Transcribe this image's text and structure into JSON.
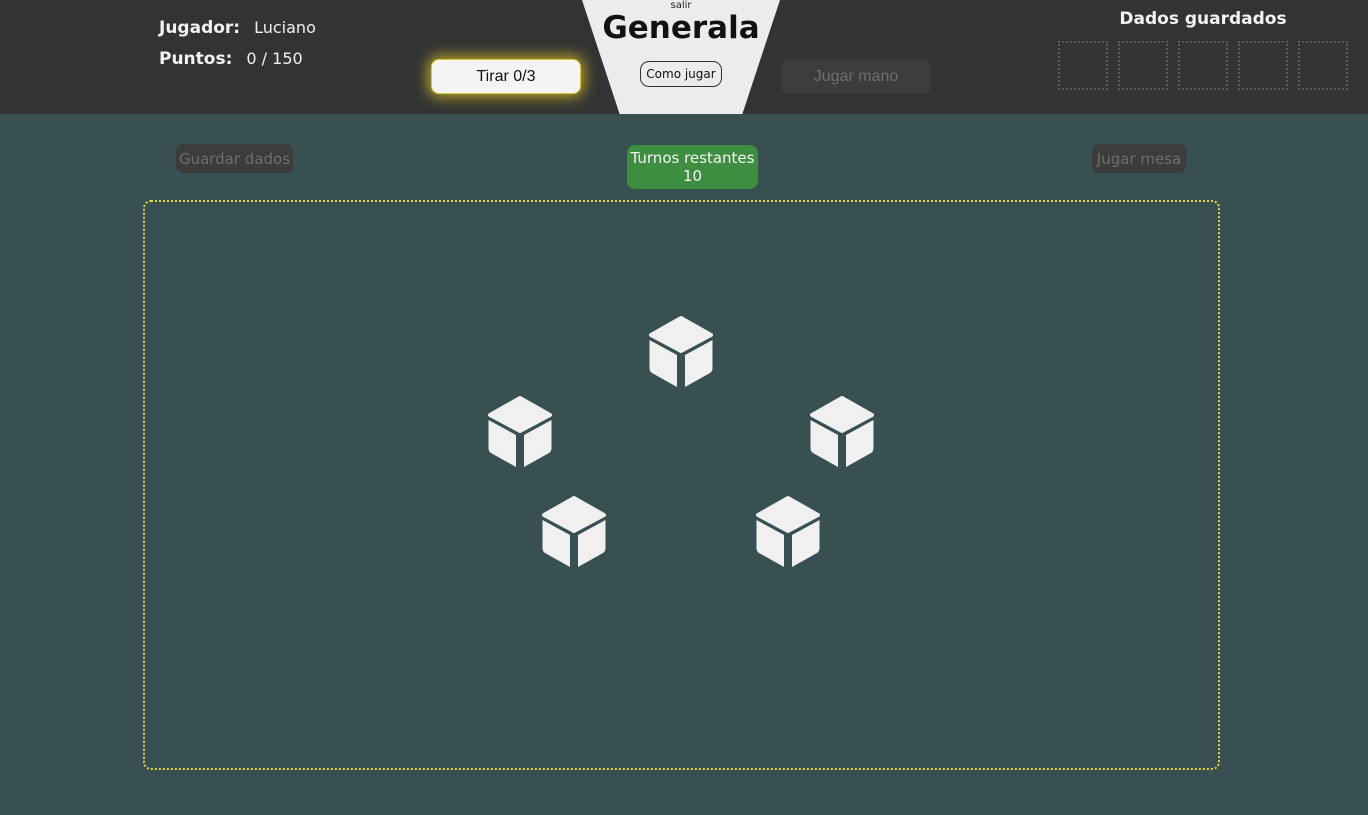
{
  "header": {
    "player_label": "Jugador:",
    "player_name": "Luciano",
    "points_label": "Puntos:",
    "points_value": "0 / 150",
    "roll_button": "Tirar 0/3",
    "exit_link": "salir",
    "title": "Generala",
    "how_to_play_button": "Como jugar",
    "play_hand_button": "Jugar mano",
    "saved_dice_title": "Dados guardados",
    "saved_dice_slots": 5
  },
  "board": {
    "save_dice_button": "Guardar dados",
    "turns_label": "Turnos restantes",
    "turns_value": "10",
    "play_table_button": "Jugar mesa",
    "dice_count": 5
  },
  "colors": {
    "header_bg": "#333333",
    "board_bg": "#385052",
    "board_border": "#e6d23a",
    "turns_badge": "#3e8e42",
    "die_face": "#f0f0f0"
  },
  "icons": {
    "die": "cube-icon"
  }
}
